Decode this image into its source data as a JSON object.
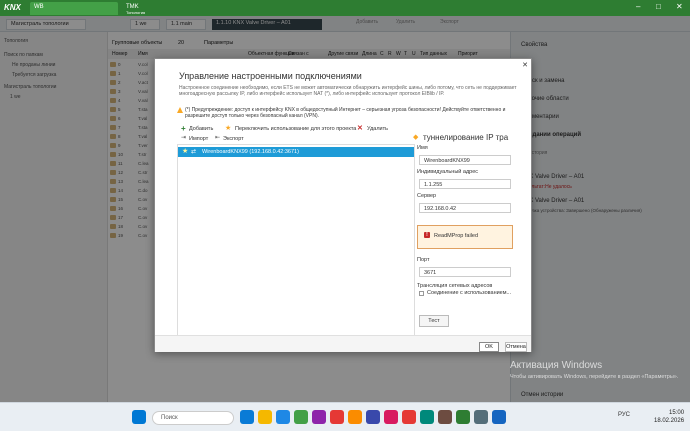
{
  "ets": {
    "brand": "KNX",
    "tabs": [
      {
        "label": "WB"
      },
      {
        "label": "TMK",
        "sublabel": "Топология"
      }
    ],
    "toolbar": {
      "items": [
        "Магистраль топологии",
        "1 we",
        "1.1 main",
        "1.1.10 KNX Valve Driver – A01"
      ],
      "actions": [
        "Добавить",
        "Удалить",
        "Экспорт"
      ]
    },
    "left_panel": {
      "header": "Топология",
      "items": [
        "Поиск по папкам",
        "Не проданы линии",
        "Требуется загрузка",
        "Магистраль топологии",
        "1 we"
      ]
    },
    "middle": {
      "tabs": [
        "Групповые объекты",
        "20",
        "Параметры"
      ],
      "columns": [
        "Номер",
        "Имя",
        "Объектная функция",
        "Связан с",
        "Другие связи",
        "Длина",
        "C",
        "R",
        "W",
        "T",
        "U",
        "Тип данных",
        "Приорит"
      ],
      "row_numbers": [
        "0",
        "1",
        "2",
        "3",
        "4",
        "5",
        "6",
        "7",
        "8",
        "9",
        "10",
        "11",
        "12",
        "13",
        "14",
        "15",
        "16",
        "17",
        "18",
        "19"
      ],
      "row_names": [
        "V.col",
        "V.col",
        "V.act",
        "V.val",
        "V.val",
        "T.sta",
        "T.val",
        "T.sta",
        "T.val",
        "T.ver",
        "T.str",
        "C.lea",
        "C.str",
        "C.lea",
        "C.do",
        "C.ov",
        "C.ov",
        "C.ov",
        "C.ov",
        "C.ov"
      ]
    },
    "right_panel": {
      "items": [
        "Свойства",
        "Поиск и замена",
        "Рабочие области",
        "Комментарии",
        "ожидании операций",
        "Не история",
        "KNX Valve Driver – A01",
        "Результат:Не удалось",
        "KNX Valve Driver – A01",
        "Загрузка устройства: Завершено (Обнаружены различия)",
        "Отмен истории"
      ],
      "error_color": "#c62828"
    },
    "activation": {
      "title": "Активация Windows",
      "text": "Чтобы активировать Windows, перейдите в раздел «Параметры»."
    }
  },
  "dialog": {
    "close_glyph": "✕",
    "title": "Управление настроенными подключениями",
    "description": "Настроенное соединение необходимо, если ETS не может автоматически обнаружить интерфейс шины, либо потому, что сеть не поддерживает многоадресную рассылку IP, либо интерфейс использует NAT (*), либо интерфейс использует протокол EIBlib / IP.",
    "warning": "(*) Предупреждение: доступ к интерфейсу KNX в общедоступный Интернет – серьезная угроза безопасности! Действуйте ответственно и разрешите доступ только через безопасный канал (VPN).",
    "toolbar": {
      "add": "Добавить",
      "toggle_project": "Переключить использование для этого проекта",
      "delete": "Удалить",
      "import": "Импорт",
      "export": "Экспорт"
    },
    "connections": [
      {
        "label": "WirenboardKNX99 (192.168.0.42:3671)",
        "selected": true
      }
    ],
    "detail": {
      "heading": "туннелирование IP тра",
      "name_label": "Имя",
      "name_value": "WirenboardKNX99",
      "addr_label": "Индивидуальный адрес",
      "addr_value": "1.1.255",
      "server_label": "Сервер",
      "server_value": "192.168.0.42",
      "port_label": "Порт",
      "port_value": "3671",
      "nat_label": "Трансляция сетевых адресов",
      "nat_checkbox_label": "Соединение с использованием...",
      "error_text": "ReadMProp failed",
      "test_button": "Тест"
    },
    "ok_button": "OK",
    "cancel_button": "Отмена"
  },
  "taskbar": {
    "search_placeholder": "Поиск",
    "lang": "РУС",
    "time": "15:00",
    "date": "18.02.2026"
  }
}
